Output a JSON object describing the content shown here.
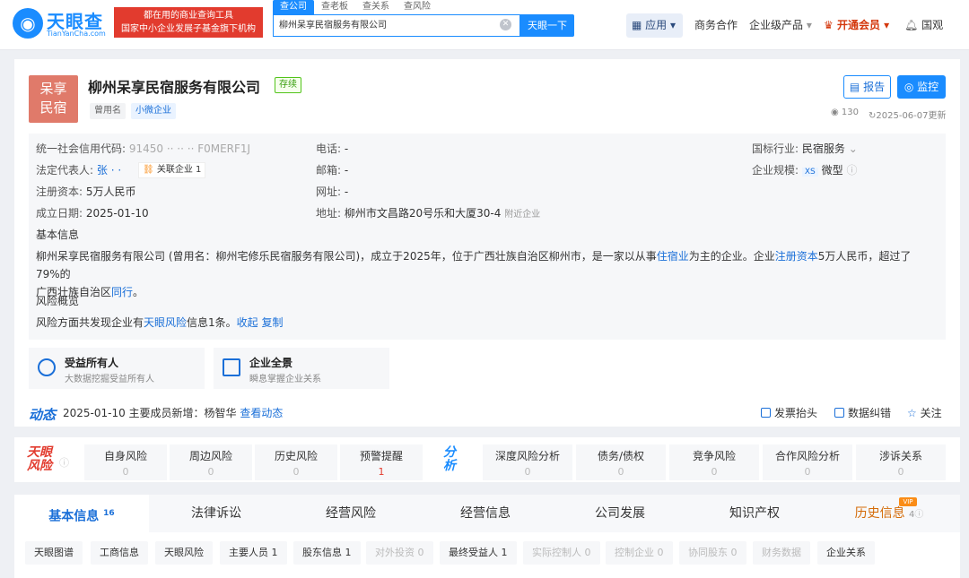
{
  "header": {
    "logo_mark": "◉",
    "logo_text": "天眼查",
    "logo_sub": "TianYanCha.com",
    "slogan_line1": "都在用的商业查询工具",
    "slogan_line2": "国家中小企业发展子基金旗下机构",
    "search_tabs": [
      "查公司",
      "查老板",
      "查关系",
      "查风险"
    ],
    "search_value": "柳州呆享民宿服务有限公司",
    "search_button": "天眼一下",
    "nav_app": "应用",
    "nav_items": [
      "商务合作",
      "企业级产品",
      "开通会员",
      "国观"
    ]
  },
  "company": {
    "avatar_line1": "呆享",
    "avatar_line2": "民宿",
    "name": "柳州呆享民宿服务有限公司",
    "status": "存续",
    "tags": [
      "曾用名",
      "小微企业"
    ],
    "report_button": "报告",
    "monitor_button": "监控",
    "views": "130",
    "updated": "2025-06-07更新"
  },
  "info": {
    "credit_code_label": "统一社会信用代码:",
    "credit_code_value": "91450 ·· ·· ·· F0MERF1J",
    "legal_label": "法定代表人:",
    "legal_value": "张 · ·",
    "related_label": "关联企业 1",
    "capital_label": "注册资本:",
    "capital_value": "5万人民币",
    "date_label": "成立日期:",
    "date_value": "2025-01-10",
    "phone_label": "电话:",
    "phone_value": "-",
    "email_label": "邮箱:",
    "email_value": "-",
    "web_label": "网址:",
    "web_value": "-",
    "address_label": "地址:",
    "address_value": "柳州市文昌路20号乐和大厦30-4",
    "nearby": "附近企业",
    "industry_label": "国标行业:",
    "industry_value": "民宿服务",
    "scale_label": "企业规模:",
    "scale_badge": "XS",
    "scale_value": "微型",
    "basic_title": "基本信息",
    "basic_p1": "柳州呆享民宿服务有限公司 (曾用名：柳州宅修乐民宿服务有限公司)，成立于2025年，位于广西壮族自治区柳州市，是一家以从事",
    "basic_link1": "住宿业",
    "basic_p2": "为主的企业。企业",
    "basic_link2": "注册资本",
    "basic_p3": "5万人民币，超过了79%的",
    "basic_p4": "广西壮族自治区",
    "basic_link3": "同行",
    "basic_p5": "。",
    "risk_title": "风险概览",
    "risk_p1": "风险方面共发现企业有",
    "risk_link": "天眼风险",
    "risk_p2": "信息1条。",
    "risk_collapse": "收起",
    "risk_copy": "复制"
  },
  "features": [
    {
      "title": "受益所有人",
      "sub": "大数据挖掘受益所有人"
    },
    {
      "title": "企业全景",
      "sub": "瞬息掌握企业关系"
    }
  ],
  "dynamic": {
    "label": "动态",
    "text": "2025-01-10 主要成员新增：杨智华",
    "link": "查看动态",
    "actions": [
      "发票抬头",
      "数据纠错",
      "关注"
    ]
  },
  "risk_bar": {
    "logo1": "天眼",
    "logo2": "风险",
    "items": [
      {
        "title": "自身风险",
        "count": "0"
      },
      {
        "title": "周边风险",
        "count": "0"
      },
      {
        "title": "历史风险",
        "count": "0"
      },
      {
        "title": "预警提醒",
        "count": "1"
      }
    ],
    "an_logo1": "分",
    "an_logo2": "析",
    "analysis": [
      {
        "title": "深度风险分析",
        "count": "0"
      },
      {
        "title": "债务/债权",
        "count": "0"
      },
      {
        "title": "竞争风险",
        "count": "0"
      },
      {
        "title": "合作风险分析",
        "count": "0"
      },
      {
        "title": "涉诉关系",
        "count": "0"
      }
    ]
  },
  "tabs": [
    {
      "label": "基本信息",
      "count": "16"
    },
    {
      "label": "法律诉讼",
      "count": ""
    },
    {
      "label": "经营风险",
      "count": ""
    },
    {
      "label": "经营信息",
      "count": ""
    },
    {
      "label": "公司发展",
      "count": ""
    },
    {
      "label": "知识产权",
      "count": ""
    },
    {
      "label": "历史信息",
      "count": "4"
    }
  ],
  "vip_badge": "VIP",
  "subtabs": [
    "天眼图谱",
    "工商信息",
    "天眼风险",
    "主要人员 1",
    "股东信息 1",
    "对外投资 0",
    "最终受益人 1",
    "实际控制人 0",
    "控制企业 0",
    "协同股东 0",
    "财务数据",
    "企业关系"
  ]
}
